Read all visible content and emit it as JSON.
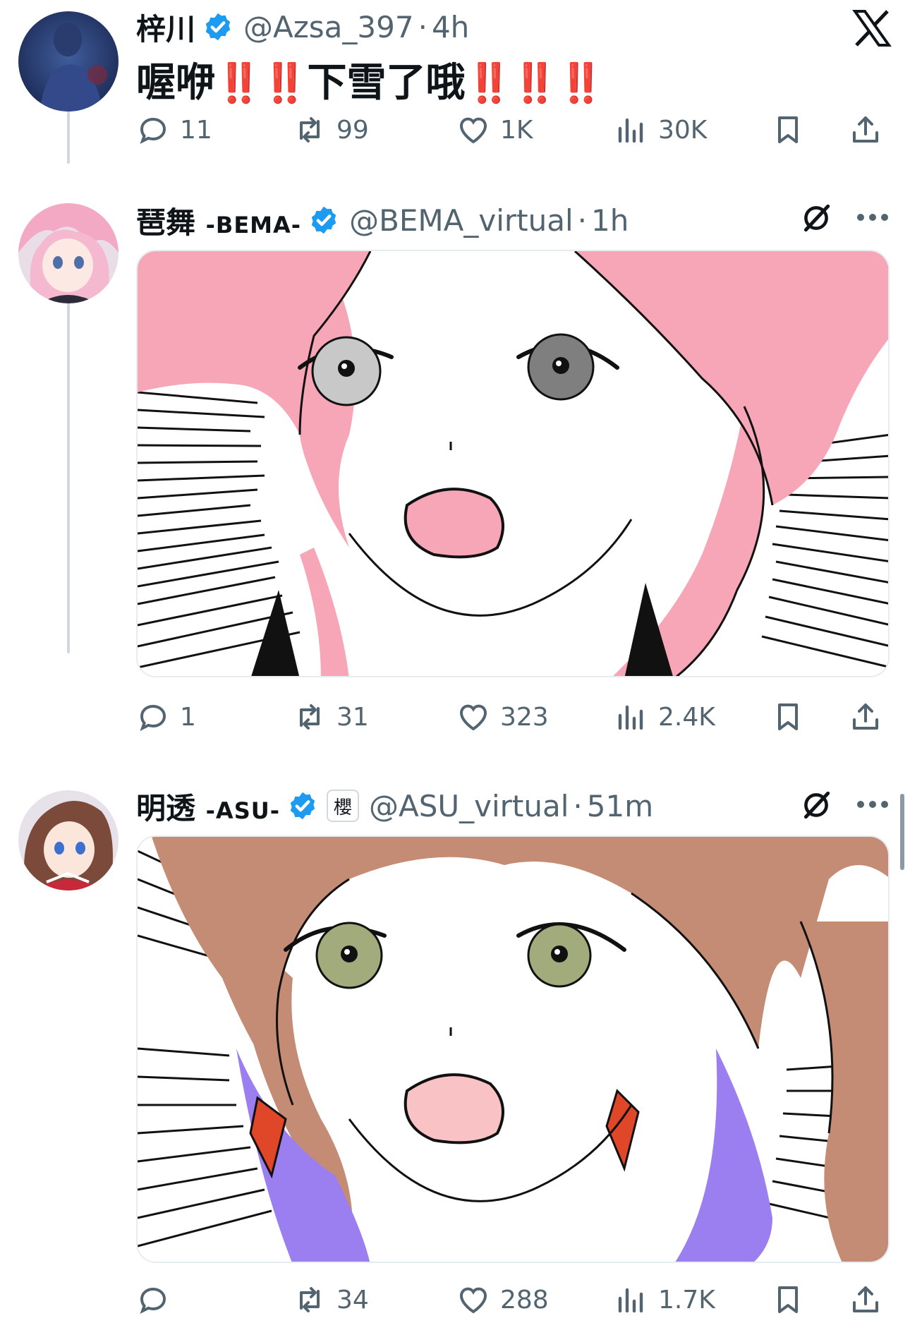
{
  "close_logo": "x-logo-icon",
  "tweets": [
    {
      "display_name": "梓川",
      "handle": "@Azsa_397",
      "separator": "·",
      "time": "4h",
      "verified": true,
      "text_a": "喔咿",
      "text_bang1": "‼️‼️",
      "text_b": "下雪了哦",
      "text_bang2": "‼️‼️‼️",
      "stats": {
        "replies": "11",
        "reposts": "99",
        "likes": "1K",
        "views": "30K"
      }
    },
    {
      "display_name": "琶舞",
      "display_tag": "-BEMA-",
      "handle": "@BEMA_virtual",
      "separator": "·",
      "time": "1h",
      "verified": true,
      "media": {
        "subject": "pink-haired surprised manga face",
        "hair_color": "#f6a6b6",
        "iris_left": "#c8c8c8",
        "iris_right": "#7f7f7f"
      },
      "stats": {
        "replies": "1",
        "reposts": "31",
        "likes": "323",
        "views": "2.4K"
      }
    },
    {
      "display_name": "明透",
      "display_tag": "-ASU-",
      "org_badge": "櫻",
      "handle": "@ASU_virtual",
      "separator": "·",
      "time": "51m",
      "verified": true,
      "media": {
        "subject": "brown-haired surprised manga face",
        "hair_color": "#c48c74",
        "iris_color": "#a2ab7c",
        "accent": "#9b7ef0"
      },
      "stats": {
        "replies": "",
        "reposts": "34",
        "likes": "288",
        "views": "1.7K"
      }
    }
  ],
  "colors": {
    "verified": "#1d9bf0",
    "muted": "#536471",
    "alert": "#e0171a"
  }
}
